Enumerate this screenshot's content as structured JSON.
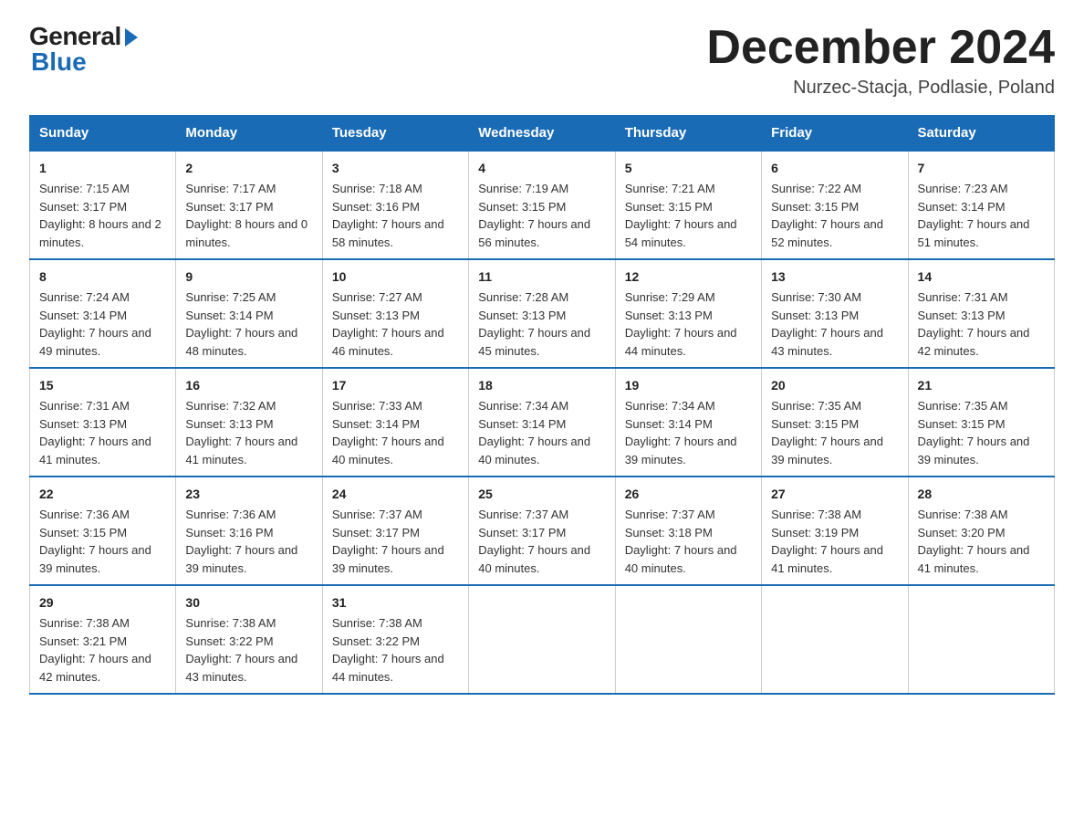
{
  "header": {
    "logo_general": "General",
    "logo_blue": "Blue",
    "title": "December 2024",
    "subtitle": "Nurzec-Stacja, Podlasie, Poland"
  },
  "calendar": {
    "days_of_week": [
      "Sunday",
      "Monday",
      "Tuesday",
      "Wednesday",
      "Thursday",
      "Friday",
      "Saturday"
    ],
    "weeks": [
      [
        {
          "day": "1",
          "sunrise": "7:15 AM",
          "sunset": "3:17 PM",
          "daylight": "8 hours and 2 minutes."
        },
        {
          "day": "2",
          "sunrise": "7:17 AM",
          "sunset": "3:17 PM",
          "daylight": "8 hours and 0 minutes."
        },
        {
          "day": "3",
          "sunrise": "7:18 AM",
          "sunset": "3:16 PM",
          "daylight": "7 hours and 58 minutes."
        },
        {
          "day": "4",
          "sunrise": "7:19 AM",
          "sunset": "3:15 PM",
          "daylight": "7 hours and 56 minutes."
        },
        {
          "day": "5",
          "sunrise": "7:21 AM",
          "sunset": "3:15 PM",
          "daylight": "7 hours and 54 minutes."
        },
        {
          "day": "6",
          "sunrise": "7:22 AM",
          "sunset": "3:15 PM",
          "daylight": "7 hours and 52 minutes."
        },
        {
          "day": "7",
          "sunrise": "7:23 AM",
          "sunset": "3:14 PM",
          "daylight": "7 hours and 51 minutes."
        }
      ],
      [
        {
          "day": "8",
          "sunrise": "7:24 AM",
          "sunset": "3:14 PM",
          "daylight": "7 hours and 49 minutes."
        },
        {
          "day": "9",
          "sunrise": "7:25 AM",
          "sunset": "3:14 PM",
          "daylight": "7 hours and 48 minutes."
        },
        {
          "day": "10",
          "sunrise": "7:27 AM",
          "sunset": "3:13 PM",
          "daylight": "7 hours and 46 minutes."
        },
        {
          "day": "11",
          "sunrise": "7:28 AM",
          "sunset": "3:13 PM",
          "daylight": "7 hours and 45 minutes."
        },
        {
          "day": "12",
          "sunrise": "7:29 AM",
          "sunset": "3:13 PM",
          "daylight": "7 hours and 44 minutes."
        },
        {
          "day": "13",
          "sunrise": "7:30 AM",
          "sunset": "3:13 PM",
          "daylight": "7 hours and 43 minutes."
        },
        {
          "day": "14",
          "sunrise": "7:31 AM",
          "sunset": "3:13 PM",
          "daylight": "7 hours and 42 minutes."
        }
      ],
      [
        {
          "day": "15",
          "sunrise": "7:31 AM",
          "sunset": "3:13 PM",
          "daylight": "7 hours and 41 minutes."
        },
        {
          "day": "16",
          "sunrise": "7:32 AM",
          "sunset": "3:13 PM",
          "daylight": "7 hours and 41 minutes."
        },
        {
          "day": "17",
          "sunrise": "7:33 AM",
          "sunset": "3:14 PM",
          "daylight": "7 hours and 40 minutes."
        },
        {
          "day": "18",
          "sunrise": "7:34 AM",
          "sunset": "3:14 PM",
          "daylight": "7 hours and 40 minutes."
        },
        {
          "day": "19",
          "sunrise": "7:34 AM",
          "sunset": "3:14 PM",
          "daylight": "7 hours and 39 minutes."
        },
        {
          "day": "20",
          "sunrise": "7:35 AM",
          "sunset": "3:15 PM",
          "daylight": "7 hours and 39 minutes."
        },
        {
          "day": "21",
          "sunrise": "7:35 AM",
          "sunset": "3:15 PM",
          "daylight": "7 hours and 39 minutes."
        }
      ],
      [
        {
          "day": "22",
          "sunrise": "7:36 AM",
          "sunset": "3:15 PM",
          "daylight": "7 hours and 39 minutes."
        },
        {
          "day": "23",
          "sunrise": "7:36 AM",
          "sunset": "3:16 PM",
          "daylight": "7 hours and 39 minutes."
        },
        {
          "day": "24",
          "sunrise": "7:37 AM",
          "sunset": "3:17 PM",
          "daylight": "7 hours and 39 minutes."
        },
        {
          "day": "25",
          "sunrise": "7:37 AM",
          "sunset": "3:17 PM",
          "daylight": "7 hours and 40 minutes."
        },
        {
          "day": "26",
          "sunrise": "7:37 AM",
          "sunset": "3:18 PM",
          "daylight": "7 hours and 40 minutes."
        },
        {
          "day": "27",
          "sunrise": "7:38 AM",
          "sunset": "3:19 PM",
          "daylight": "7 hours and 41 minutes."
        },
        {
          "day": "28",
          "sunrise": "7:38 AM",
          "sunset": "3:20 PM",
          "daylight": "7 hours and 41 minutes."
        }
      ],
      [
        {
          "day": "29",
          "sunrise": "7:38 AM",
          "sunset": "3:21 PM",
          "daylight": "7 hours and 42 minutes."
        },
        {
          "day": "30",
          "sunrise": "7:38 AM",
          "sunset": "3:22 PM",
          "daylight": "7 hours and 43 minutes."
        },
        {
          "day": "31",
          "sunrise": "7:38 AM",
          "sunset": "3:22 PM",
          "daylight": "7 hours and 44 minutes."
        },
        null,
        null,
        null,
        null
      ]
    ]
  }
}
